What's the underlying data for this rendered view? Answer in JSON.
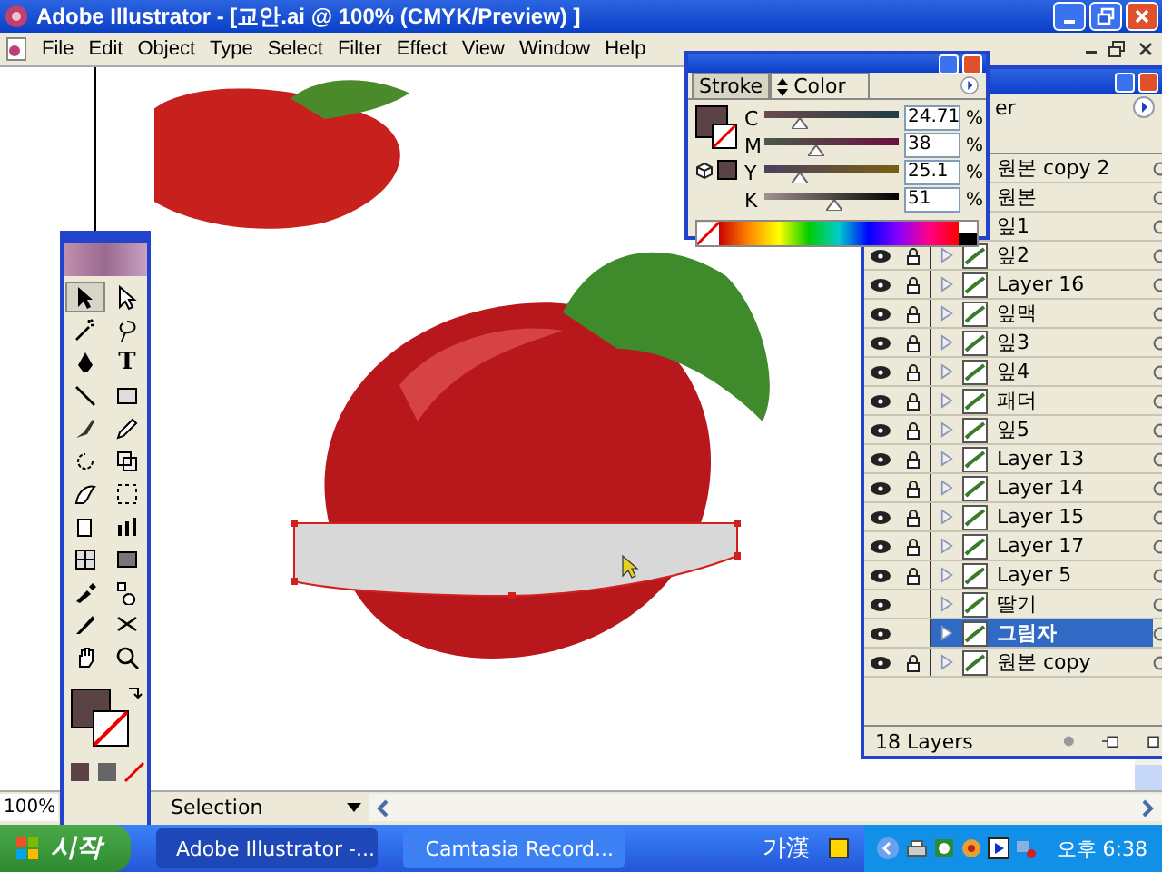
{
  "window": {
    "title": "Adobe Illustrator - [교안.ai @ 100% (CMYK/Preview) ]"
  },
  "menu": [
    "File",
    "Edit",
    "Object",
    "Type",
    "Select",
    "Filter",
    "Effect",
    "View",
    "Window",
    "Help"
  ],
  "tools": [
    {
      "kind": "arrow",
      "selected": true
    },
    {
      "kind": "direct",
      "selected": false
    },
    {
      "kind": "wand",
      "selected": false
    },
    {
      "kind": "lasso",
      "selected": false
    },
    {
      "kind": "pen",
      "selected": false
    },
    {
      "kind": "type",
      "label": "T",
      "selected": false
    },
    {
      "kind": "line",
      "selected": false
    },
    {
      "kind": "rect",
      "selected": false
    },
    {
      "kind": "brush",
      "selected": false
    },
    {
      "kind": "pencil",
      "selected": false
    },
    {
      "kind": "rotate",
      "selected": false
    },
    {
      "kind": "scale",
      "selected": false
    },
    {
      "kind": "warp",
      "selected": false
    },
    {
      "kind": "transform",
      "selected": false
    },
    {
      "kind": "symbol",
      "selected": false
    },
    {
      "kind": "graph",
      "selected": false
    },
    {
      "kind": "mesh",
      "selected": false
    },
    {
      "kind": "gradient",
      "selected": false
    },
    {
      "kind": "eyedropper",
      "selected": false
    },
    {
      "kind": "blend",
      "selected": false
    },
    {
      "kind": "knife",
      "selected": false
    },
    {
      "kind": "scissors",
      "selected": false
    },
    {
      "kind": "hand",
      "selected": false
    },
    {
      "kind": "zoom",
      "selected": false
    }
  ],
  "color_panel": {
    "tabs": [
      {
        "label": "Stroke",
        "selected": false
      },
      {
        "label": "Color",
        "selected": true
      }
    ],
    "channels": [
      {
        "name": "C",
        "level": 0.25,
        "value": "24.71",
        "unit": "%"
      },
      {
        "name": "M",
        "level": 0.38,
        "value": "38",
        "unit": "%"
      },
      {
        "name": "Y",
        "level": 0.25,
        "value": "25.1",
        "unit": "%"
      },
      {
        "name": "K",
        "level": 0.51,
        "value": "51",
        "unit": "%"
      }
    ]
  },
  "layers_panel": {
    "tab": "er",
    "count": "18 Layers",
    "layers": [
      {
        "name": "원본 copy 2",
        "selected": false
      },
      {
        "name": "원본",
        "selected": false
      },
      {
        "name": "잎1",
        "selected": false
      },
      {
        "name": "잎2",
        "locked": true,
        "selected": false
      },
      {
        "name": "Layer 16",
        "locked": true,
        "selected": false
      },
      {
        "name": "잎맥",
        "locked": true,
        "selected": false
      },
      {
        "name": "잎3",
        "locked": true,
        "selected": false
      },
      {
        "name": "잎4",
        "locked": true,
        "selected": false
      },
      {
        "name": "패더",
        "locked": true,
        "selected": false
      },
      {
        "name": "잎5",
        "locked": true,
        "selected": false
      },
      {
        "name": "Layer 13",
        "locked": true,
        "selected": false
      },
      {
        "name": "Layer 14",
        "locked": true,
        "selected": false
      },
      {
        "name": "Layer 15",
        "locked": true,
        "selected": false
      },
      {
        "name": "Layer 17",
        "locked": true,
        "selected": false
      },
      {
        "name": "Layer 5",
        "locked": true,
        "selected": false
      },
      {
        "name": "딸기",
        "locked": false,
        "selected": false
      },
      {
        "name": "그림자",
        "locked": false,
        "selected": true
      },
      {
        "name": "원본 copy",
        "locked": true,
        "selected": false
      }
    ]
  },
  "status_bar": {
    "zoom": "100%",
    "tool": "Selection"
  },
  "taskbar": {
    "start": "시작",
    "tasks": [
      {
        "label": "Adobe Illustrator -...",
        "selected": true
      },
      {
        "label": "Camtasia Record...",
        "selected": false
      }
    ],
    "ime": "가漢",
    "clock": "오후 6:38"
  }
}
